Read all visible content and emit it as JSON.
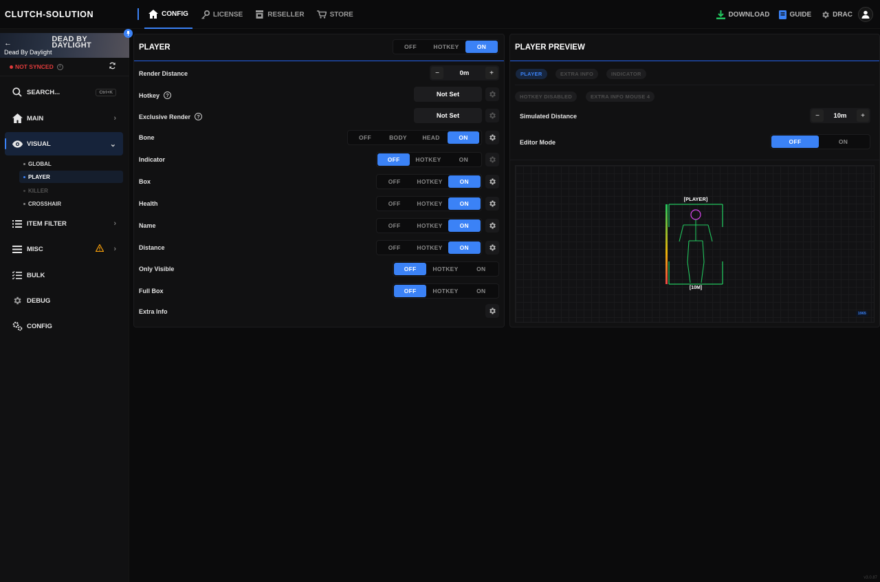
{
  "brand": "CLUTCH-SOLUTION",
  "top_nav": [
    {
      "label": "CONFIG",
      "icon": "home-icon",
      "active": true
    },
    {
      "label": "LICENSE",
      "icon": "key-icon",
      "active": false
    },
    {
      "label": "RESELLER",
      "icon": "store-icon",
      "active": false
    },
    {
      "label": "STORE",
      "icon": "cart-icon",
      "active": false
    }
  ],
  "right_nav": {
    "download": "DOWNLOAD",
    "guide": "GUIDE",
    "user": "DRAC"
  },
  "game": {
    "logo_line1": "DEAD BY",
    "logo_line2": "DAYLIGHT",
    "name": "Dead By Daylight",
    "sync_status": "NOT SYNCED"
  },
  "sidebar": {
    "search": {
      "label": "SEARCH...",
      "shortcut": "Ctrl+K"
    },
    "items": [
      {
        "label": "MAIN",
        "icon": "home-icon"
      },
      {
        "label": "VISUAL",
        "icon": "eye-icon",
        "active": true
      },
      {
        "label": "ITEM FILTER",
        "icon": "list-icon"
      },
      {
        "label": "MISC",
        "icon": "menu-icon",
        "warning": true
      },
      {
        "label": "BULK",
        "icon": "checklist-icon"
      },
      {
        "label": "DEBUG",
        "icon": "gear-icon"
      },
      {
        "label": "CONFIG",
        "icon": "gears-icon"
      }
    ],
    "visual_sub": [
      {
        "label": "GLOBAL"
      },
      {
        "label": "PLAYER",
        "active": true
      },
      {
        "label": "KILLER",
        "disabled": true
      },
      {
        "label": "CROSSHAIR"
      }
    ]
  },
  "player_panel": {
    "title": "PLAYER",
    "mode": {
      "options": [
        "OFF",
        "HOTKEY",
        "ON"
      ],
      "selected": "ON"
    },
    "render_distance": {
      "label": "Render Distance",
      "value": "0m",
      "minus": "−",
      "plus": "+"
    },
    "hotkey": {
      "label": "Hotkey",
      "value": "Not Set"
    },
    "exclusive_render": {
      "label": "Exclusive Render",
      "value": "Not Set"
    },
    "bone": {
      "label": "Bone",
      "options": [
        "OFF",
        "BODY",
        "HEAD",
        "ON"
      ],
      "selected": "ON"
    },
    "indicator": {
      "label": "Indicator",
      "options": [
        "OFF",
        "HOTKEY",
        "ON"
      ],
      "selected": "OFF"
    },
    "box": {
      "label": "Box",
      "options": [
        "OFF",
        "HOTKEY",
        "ON"
      ],
      "selected": "ON"
    },
    "health": {
      "label": "Health",
      "options": [
        "OFF",
        "HOTKEY",
        "ON"
      ],
      "selected": "ON"
    },
    "name": {
      "label": "Name",
      "options": [
        "OFF",
        "HOTKEY",
        "ON"
      ],
      "selected": "ON"
    },
    "distance": {
      "label": "Distance",
      "options": [
        "OFF",
        "HOTKEY",
        "ON"
      ],
      "selected": "ON"
    },
    "only_visible": {
      "label": "Only Visible",
      "options": [
        "OFF",
        "HOTKEY",
        "ON"
      ],
      "selected": "OFF"
    },
    "full_box": {
      "label": "Full Box",
      "options": [
        "OFF",
        "HOTKEY",
        "ON"
      ],
      "selected": "OFF"
    },
    "extra_info": {
      "label": "Extra Info"
    }
  },
  "preview_panel": {
    "title": "PLAYER PREVIEW",
    "tabs": [
      {
        "label": "PLAYER",
        "active": true
      },
      {
        "label": "EXTRA INFO"
      },
      {
        "label": "INDICATOR"
      }
    ],
    "badges": [
      "HOTKEY DISABLED",
      "EXTRA INFO MOUSE 4"
    ],
    "simulated_distance": {
      "label": "Simulated Distance",
      "value": "10m",
      "minus": "−",
      "plus": "+"
    },
    "editor_mode": {
      "label": "Editor Mode",
      "options": [
        "OFF",
        "ON"
      ],
      "selected": "OFF"
    },
    "preview": {
      "player_label": "[PLAYER]",
      "distance_label": "[10M]",
      "fps": "1965",
      "health_fraction": 1.0,
      "box_color": "#22c55e",
      "skeleton_color": "#22c55e",
      "head_color": "#d946ef"
    }
  },
  "version": "v3.0.87",
  "accent_color": "#3b82f6"
}
